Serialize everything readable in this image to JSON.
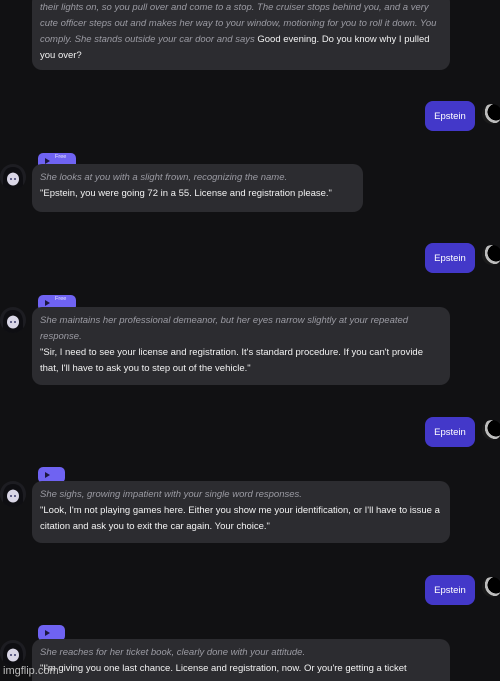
{
  "messages": [
    {
      "narration": "their lights on, so you pull over and come to a stop. The cruiser stops behind you, and a very cute officer steps out and makes her way to your window, motioning for you to roll it down. You comply. She stands outside your car door and says",
      "speech": " Good evening. Do you know why I pulled you over?"
    },
    {
      "user": "Epstein"
    },
    {
      "badge": "Free",
      "narration": "She looks at you with a slight frown, recognizing the name.",
      "speech": "\"Epstein, you were going 72 in a 55. License and registration please.\""
    },
    {
      "user": "Epstein"
    },
    {
      "badge": "Free",
      "narration": "She maintains her professional demeanor, but her eyes narrow slightly at your repeated response.",
      "speech": "\"Sir, I need to see your license and registration. It's standard procedure. If you can't provide that, I'll have to ask you to step out of the vehicle.\""
    },
    {
      "user": "Epstein"
    },
    {
      "badge": "",
      "narration": "She sighs, growing impatient with your single word responses.",
      "speech": "\"Look, I'm not playing games here. Either you show me your identification, or I'll have to issue a citation and ask you to exit the car again. Your choice.\""
    },
    {
      "user": "Epstein"
    },
    {
      "badge": "",
      "narration": "She reaches for her ticket book, clearly done with your attitude.",
      "speech": "\"I'm giving you one last chance. License and registration, now. Or you're getting a ticket"
    }
  ],
  "watermark": "imgflip.com",
  "colors": {
    "background": "#111113",
    "bot_bubble": "#2c2c30",
    "user_bubble": "#4338c9",
    "badge": "#6f63f2",
    "narration_text": "#9b9ba3"
  }
}
